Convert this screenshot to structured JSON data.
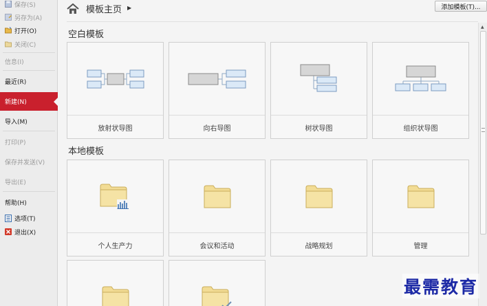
{
  "sidebar": {
    "items": [
      {
        "label": "保存(S)",
        "state": "dim"
      },
      {
        "label": "另存为(A)",
        "state": "dim"
      },
      {
        "label": "打开(O)",
        "state": "normal"
      },
      {
        "label": "关闭(C)",
        "state": "dim"
      },
      {
        "label": "信息(I)",
        "state": "dim"
      },
      {
        "label": "最近(R)",
        "state": "normal"
      },
      {
        "label": "新建(N)",
        "state": "active"
      },
      {
        "label": "导入(M)",
        "state": "normal"
      },
      {
        "label": "打印(P)",
        "state": "dim"
      },
      {
        "label": "保存并发送(V)",
        "state": "dim"
      },
      {
        "label": "导出(E)",
        "state": "dim"
      },
      {
        "label": "帮助(H)",
        "state": "normal"
      },
      {
        "label": "选项(T)",
        "state": "normal"
      },
      {
        "label": "退出(X)",
        "state": "normal"
      }
    ]
  },
  "header": {
    "breadcrumb": "模板主页",
    "add_template_button": "添加模板(T)..."
  },
  "sections": {
    "blank": {
      "title": "空白模板",
      "cards": [
        {
          "label": "放射状导图",
          "icon": "radial-map-icon"
        },
        {
          "label": "向右导图",
          "icon": "right-map-icon"
        },
        {
          "label": "树状导图",
          "icon": "tree-map-icon"
        },
        {
          "label": "组织状导图",
          "icon": "org-chart-icon"
        }
      ]
    },
    "local": {
      "title": "本地模板",
      "cards": [
        {
          "label": "个人生产力",
          "icon": "folder-chart-icon"
        },
        {
          "label": "会议和活动",
          "icon": "folder-icon"
        },
        {
          "label": "战略规划",
          "icon": "folder-icon"
        },
        {
          "label": "管理",
          "icon": "folder-icon"
        },
        {
          "label": "",
          "icon": "folder-icon"
        },
        {
          "label": "",
          "icon": "folder-check-icon"
        }
      ]
    }
  },
  "watermark": "最需教育",
  "colors": {
    "accent_active": "#c9202d",
    "folder_fill": "#f2dc95",
    "node_blue": "#dbe9f7",
    "node_gray": "#d6d6d6",
    "watermark": "#1d2aa6"
  }
}
